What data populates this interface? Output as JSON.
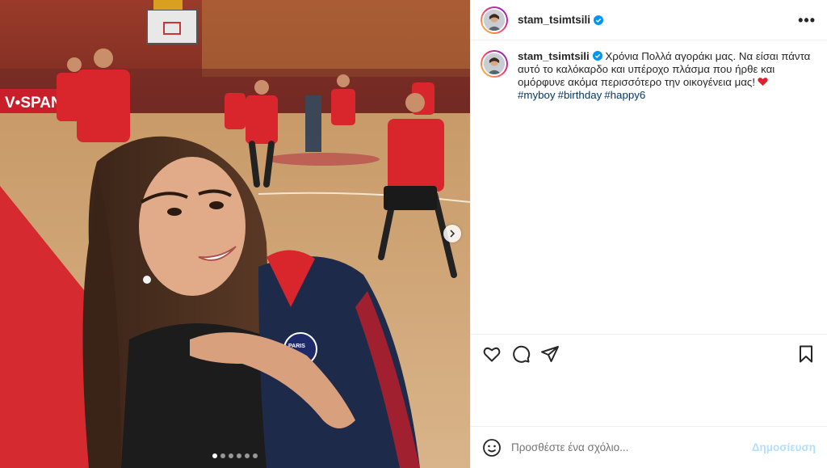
{
  "post": {
    "username": "stam_tsimtsili",
    "verified": true,
    "caption": "Χρόνια Πολλά αγοράκι μας. Να είσαι πάντα αυτό το καλόκαρδο και υπέροχο πλάσμα που ήρθε και ομόρφυνε ακόμα περισσότερο την οικογένεια μας!",
    "hashtags": [
      "#myboy",
      "#birthday",
      "#happy6"
    ],
    "more_label": "•••"
  },
  "media": {
    "court_banner_text": "V•SPAN",
    "jersey_text": "PARIS",
    "carousel_dots": 6,
    "active_dot": 0
  },
  "comment": {
    "placeholder": "Προσθέστε ένα σχόλιο...",
    "post_label": "Δημοσίευση"
  },
  "colors": {
    "verified": "#0095f6",
    "hashtag": "#00376b",
    "post_button": "#b2dffc",
    "jersey_red": "#d9262c"
  }
}
